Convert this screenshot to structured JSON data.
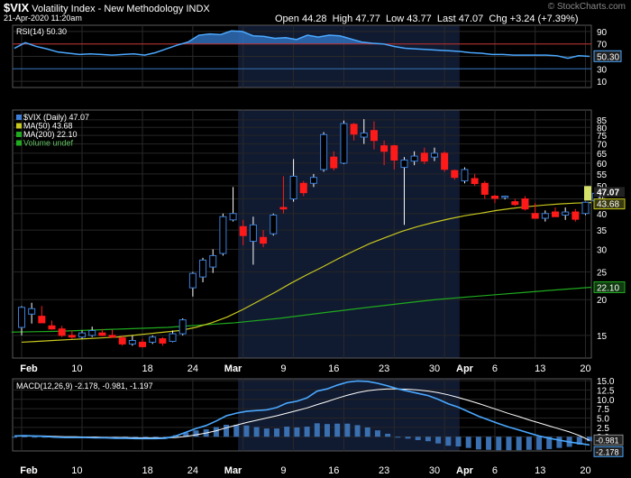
{
  "header": {
    "symbol": "$VIX",
    "name": "Volatility Index - New Methodology",
    "exchange": "INDX",
    "date": "21-Apr-2020 11:20am",
    "watermark": "© StockCharts.com",
    "open_label": "Open",
    "open": "44.28",
    "high_label": "High",
    "high": "47.77",
    "low_label": "Low",
    "low": "43.77",
    "last_label": "Last",
    "last": "47.07",
    "chg_label": "Chg",
    "chg": "+3.24 (+7.39%)"
  },
  "colors": {
    "up": "#3c7ed8",
    "down": "#ff1a1a",
    "ma50": "#c8c81e",
    "ma200": "#1faa1f",
    "rsi": "#4aa8ff",
    "macd": "#4aa8ff",
    "signal": "#ffffff",
    "hist": "#3a6fb0",
    "shade": "#101a30"
  },
  "chart_data": [
    {
      "type": "line",
      "panel": "RSI",
      "legend": "RSI(14) 50.30",
      "y_ticks": [
        "90",
        "70",
        "50",
        "30",
        "10"
      ],
      "last_label": "50.30",
      "overbought": 70,
      "oversold": 30,
      "ylim": [
        0,
        100
      ],
      "values": [
        63,
        72,
        66,
        62,
        57,
        55,
        53,
        54,
        53,
        52,
        53,
        54,
        52,
        56,
        62,
        68,
        73,
        84,
        86,
        85,
        91,
        90,
        83,
        82,
        79,
        80,
        77,
        84,
        81,
        84,
        83,
        78,
        73,
        71,
        70,
        66,
        63,
        62,
        61,
        60,
        59,
        58,
        56,
        55,
        53,
        53,
        52,
        52,
        52,
        52,
        51,
        47,
        51,
        50
      ]
    },
    {
      "type": "candlestick",
      "panel": "Price",
      "legend": [
        "$VIX (Daily) 47.07",
        "MA(50) 43.68",
        "MA(200) 22.10",
        "Volume undef"
      ],
      "y_scale": "log",
      "ylim": [
        12.5,
        92
      ],
      "y_ticks": [
        "85",
        "80",
        "75",
        "70",
        "65",
        "60",
        "55",
        "50",
        "45",
        "40",
        "35",
        "30",
        "25",
        "20",
        "15"
      ],
      "price_labels": {
        "last": "47.07",
        "ma50": "43.68",
        "ma200": "22.10"
      },
      "x_ticks": [
        "Feb",
        "10",
        "18",
        "24",
        "Mar",
        "9",
        "16",
        "23",
        "30",
        "Apr",
        "6",
        "13",
        "20"
      ],
      "candles": [
        {
          "date": "2020-01-29",
          "o": 16.0,
          "h": 19.0,
          "l": 15.0,
          "c": 18.8
        },
        {
          "date": "2020-01-30",
          "o": 17.8,
          "h": 19.5,
          "l": 16.5,
          "c": 18.6
        },
        {
          "date": "2020-01-31",
          "o": 17.5,
          "h": 19.0,
          "l": 16.6,
          "c": 16.6
        },
        {
          "date": "2020-02-03",
          "o": 16.2,
          "h": 16.9,
          "l": 15.7,
          "c": 15.8
        },
        {
          "date": "2020-02-04",
          "o": 15.8,
          "h": 16.2,
          "l": 14.8,
          "c": 15.0
        },
        {
          "date": "2020-02-05",
          "o": 15.0,
          "h": 15.6,
          "l": 14.6,
          "c": 14.8
        },
        {
          "date": "2020-02-06",
          "o": 14.8,
          "h": 15.6,
          "l": 14.6,
          "c": 15.3
        },
        {
          "date": "2020-02-07",
          "o": 15.0,
          "h": 16.1,
          "l": 14.8,
          "c": 15.6
        },
        {
          "date": "2020-02-10",
          "o": 15.3,
          "h": 15.8,
          "l": 14.9,
          "c": 15.0
        },
        {
          "date": "2020-02-11",
          "o": 15.0,
          "h": 15.7,
          "l": 14.7,
          "c": 14.8
        },
        {
          "date": "2020-02-12",
          "o": 14.7,
          "h": 15.0,
          "l": 13.8,
          "c": 14.0
        },
        {
          "date": "2020-02-13",
          "o": 14.0,
          "h": 15.0,
          "l": 13.8,
          "c": 14.4
        },
        {
          "date": "2020-02-14",
          "o": 14.2,
          "h": 14.6,
          "l": 13.6,
          "c": 13.7
        },
        {
          "date": "2020-02-18",
          "o": 14.2,
          "h": 15.0,
          "l": 14.0,
          "c": 14.8
        },
        {
          "date": "2020-02-19",
          "o": 14.6,
          "h": 14.8,
          "l": 13.8,
          "c": 14.1
        },
        {
          "date": "2020-02-20",
          "o": 14.3,
          "h": 15.6,
          "l": 14.2,
          "c": 15.2
        },
        {
          "date": "2020-02-21",
          "o": 15.2,
          "h": 17.2,
          "l": 15.0,
          "c": 17.0
        },
        {
          "date": "2020-02-24",
          "o": 22.0,
          "h": 25.0,
          "l": 20.5,
          "c": 24.7
        },
        {
          "date": "2020-02-25",
          "o": 24.0,
          "h": 28.0,
          "l": 23.0,
          "c": 27.5
        },
        {
          "date": "2020-02-26",
          "o": 26.0,
          "h": 30.0,
          "l": 24.8,
          "c": 28.5
        },
        {
          "date": "2020-02-27",
          "o": 29.0,
          "h": 40.0,
          "l": 28.5,
          "c": 39.0
        },
        {
          "date": "2020-02-28",
          "o": 38.0,
          "h": 49.5,
          "l": 37.5,
          "c": 40.0
        },
        {
          "date": "2020-03-02",
          "o": 36.0,
          "h": 38.0,
          "l": 31.0,
          "c": 33.5
        },
        {
          "date": "2020-03-03",
          "o": 32.0,
          "h": 39.0,
          "l": 26.5,
          "c": 36.5
        },
        {
          "date": "2020-03-04",
          "o": 33.0,
          "h": 35.0,
          "l": 30.5,
          "c": 31.5
        },
        {
          "date": "2020-03-05",
          "o": 34.0,
          "h": 40.0,
          "l": 33.5,
          "c": 39.5
        },
        {
          "date": "2020-03-06",
          "o": 42.0,
          "h": 54.0,
          "l": 40.0,
          "c": 41.5
        },
        {
          "date": "2020-03-09",
          "o": 45.0,
          "h": 62.0,
          "l": 44.0,
          "c": 54.0
        },
        {
          "date": "2020-03-10",
          "o": 51.0,
          "h": 52.0,
          "l": 46.0,
          "c": 47.3
        },
        {
          "date": "2020-03-11",
          "o": 51.0,
          "h": 55.0,
          "l": 49.5,
          "c": 53.5
        },
        {
          "date": "2020-03-12",
          "o": 57.0,
          "h": 77.0,
          "l": 56.0,
          "c": 75.5
        },
        {
          "date": "2020-03-13",
          "o": 63.0,
          "h": 66.0,
          "l": 56.5,
          "c": 57.8
        },
        {
          "date": "2020-03-16",
          "o": 60.0,
          "h": 84.5,
          "l": 59.5,
          "c": 82.5
        },
        {
          "date": "2020-03-17",
          "o": 82.0,
          "h": 83.0,
          "l": 72.0,
          "c": 75.8
        },
        {
          "date": "2020-03-18",
          "o": 74.0,
          "h": 85.5,
          "l": 70.0,
          "c": 76.5
        },
        {
          "date": "2020-03-19",
          "o": 78.0,
          "h": 84.0,
          "l": 67.0,
          "c": 72.0
        },
        {
          "date": "2020-03-20",
          "o": 69.0,
          "h": 72.0,
          "l": 59.0,
          "c": 66.0
        },
        {
          "date": "2020-03-23",
          "o": 69.0,
          "h": 69.5,
          "l": 57.0,
          "c": 61.5
        },
        {
          "date": "2020-03-24",
          "o": 58.0,
          "h": 63.0,
          "l": 36.5,
          "c": 61.5
        },
        {
          "date": "2020-03-25",
          "o": 61.0,
          "h": 66.0,
          "l": 59.0,
          "c": 63.5
        },
        {
          "date": "2020-03-26",
          "o": 65.0,
          "h": 68.0,
          "l": 59.5,
          "c": 61.0
        },
        {
          "date": "2020-03-27",
          "o": 63.0,
          "h": 68.0,
          "l": 61.0,
          "c": 65.0
        },
        {
          "date": "2020-03-30",
          "o": 65.0,
          "h": 66.0,
          "l": 56.0,
          "c": 57.1
        },
        {
          "date": "2020-03-31",
          "o": 56.5,
          "h": 57.0,
          "l": 52.5,
          "c": 53.5
        },
        {
          "date": "2020-04-01",
          "o": 52.0,
          "h": 58.0,
          "l": 51.0,
          "c": 57.0
        },
        {
          "date": "2020-04-02",
          "o": 53.0,
          "h": 55.0,
          "l": 50.0,
          "c": 50.9
        },
        {
          "date": "2020-04-03",
          "o": 51.0,
          "h": 52.0,
          "l": 45.0,
          "c": 46.7
        },
        {
          "date": "2020-04-06",
          "o": 46.0,
          "h": 46.5,
          "l": 43.5,
          "c": 45.2
        },
        {
          "date": "2020-04-07",
          "o": 45.5,
          "h": 46.2,
          "l": 44.8,
          "c": 46.0
        },
        {
          "date": "2020-04-08",
          "o": 44.0,
          "h": 45.0,
          "l": 42.5,
          "c": 43.0
        },
        {
          "date": "2020-04-09",
          "o": 45.0,
          "h": 46.0,
          "l": 41.0,
          "c": 41.5
        },
        {
          "date": "2020-04-13",
          "o": 40.0,
          "h": 43.5,
          "l": 38.5,
          "c": 38.5
        },
        {
          "date": "2020-04-14",
          "o": 38.5,
          "h": 41.0,
          "l": 37.5,
          "c": 40.0
        },
        {
          "date": "2020-04-15",
          "o": 40.5,
          "h": 42.0,
          "l": 39.5,
          "c": 39.0
        },
        {
          "date": "2020-04-16",
          "o": 39.5,
          "h": 42.0,
          "l": 38.0,
          "c": 40.5
        },
        {
          "date": "2020-04-17",
          "o": 40.5,
          "h": 41.5,
          "l": 37.5,
          "c": 38.2
        },
        {
          "date": "2020-04-20",
          "o": 40.0,
          "h": 44.0,
          "l": 39.5,
          "c": 43.8
        },
        {
          "date": "2020-04-21",
          "o": 44.3,
          "h": 47.8,
          "l": 43.8,
          "c": 47.07
        }
      ],
      "ma50": [
        14.2,
        14.3,
        14.4,
        14.5,
        14.6,
        14.7,
        14.8,
        15.0,
        15.2,
        15.4,
        15.6,
        16.0,
        16.6,
        17.4,
        18.5,
        19.8,
        21.2,
        22.8,
        24.4,
        26.0,
        27.8,
        29.6,
        31.4,
        33.0,
        34.6,
        36.0,
        37.2,
        38.3,
        39.3,
        40.1,
        41.0,
        41.7,
        42.3,
        42.8,
        43.2,
        43.5,
        43.68
      ],
      "ma200": [
        15.4,
        15.45,
        15.5,
        15.6,
        15.7,
        15.8,
        15.9,
        16.0,
        16.2,
        16.4,
        16.6,
        16.9,
        17.2,
        17.6,
        18.0,
        18.4,
        18.8,
        19.2,
        19.6,
        20.0,
        20.3,
        20.6,
        20.9,
        21.2,
        21.5,
        21.8,
        22.1
      ]
    },
    {
      "type": "line",
      "panel": "MACD",
      "legend": "MACD(12,26,9) -2.178, -0.981, -1.197",
      "y_ticks": [
        "15.0",
        "12.5",
        "10.0",
        "7.5",
        "5.0",
        "2.5",
        "0.0"
      ],
      "last_labels": [
        "-0.981",
        "-2.178"
      ],
      "ylim": [
        -3.8,
        15.5
      ],
      "x_ticks": [
        "Feb",
        "10",
        "18",
        "24",
        "Mar",
        "9",
        "16",
        "23",
        "30",
        "Apr",
        "6",
        "13",
        "20"
      ],
      "macd": [
        0.2,
        0.3,
        0.2,
        0.1,
        -0.1,
        -0.2,
        -0.2,
        -0.2,
        -0.3,
        -0.3,
        -0.4,
        -0.4,
        -0.5,
        -0.5,
        -0.5,
        -0.4,
        0.2,
        1.2,
        2.2,
        3.0,
        4.2,
        5.6,
        6.3,
        6.8,
        7.0,
        7.2,
        7.8,
        9.0,
        9.5,
        10.4,
        12.2,
        12.8,
        13.8,
        14.6,
        14.9,
        14.8,
        14.3,
        13.6,
        12.8,
        12.2,
        11.6,
        11.0,
        10.0,
        8.8,
        7.9,
        6.7,
        5.5,
        4.5,
        3.5,
        2.6,
        1.8,
        1.0,
        0.2,
        -0.4,
        -0.9,
        -1.4,
        -1.8,
        -2.178
      ],
      "signal": [
        0.2,
        0.2,
        0.2,
        0.2,
        0.1,
        0.0,
        0.0,
        -0.1,
        -0.1,
        -0.2,
        -0.2,
        -0.2,
        -0.3,
        -0.3,
        -0.3,
        -0.3,
        -0.2,
        0.1,
        0.5,
        1.0,
        1.6,
        2.4,
        3.1,
        3.8,
        4.4,
        5.0,
        5.6,
        6.3,
        7.0,
        7.7,
        8.6,
        9.4,
        10.3,
        11.1,
        11.8,
        12.3,
        12.6,
        12.8,
        12.8,
        12.7,
        12.5,
        12.2,
        11.8,
        11.2,
        10.5,
        9.7,
        8.9,
        8.0,
        7.1,
        6.2,
        5.4,
        4.5,
        3.7,
        2.9,
        2.1,
        1.3,
        0.3,
        -0.981
      ]
    }
  ]
}
